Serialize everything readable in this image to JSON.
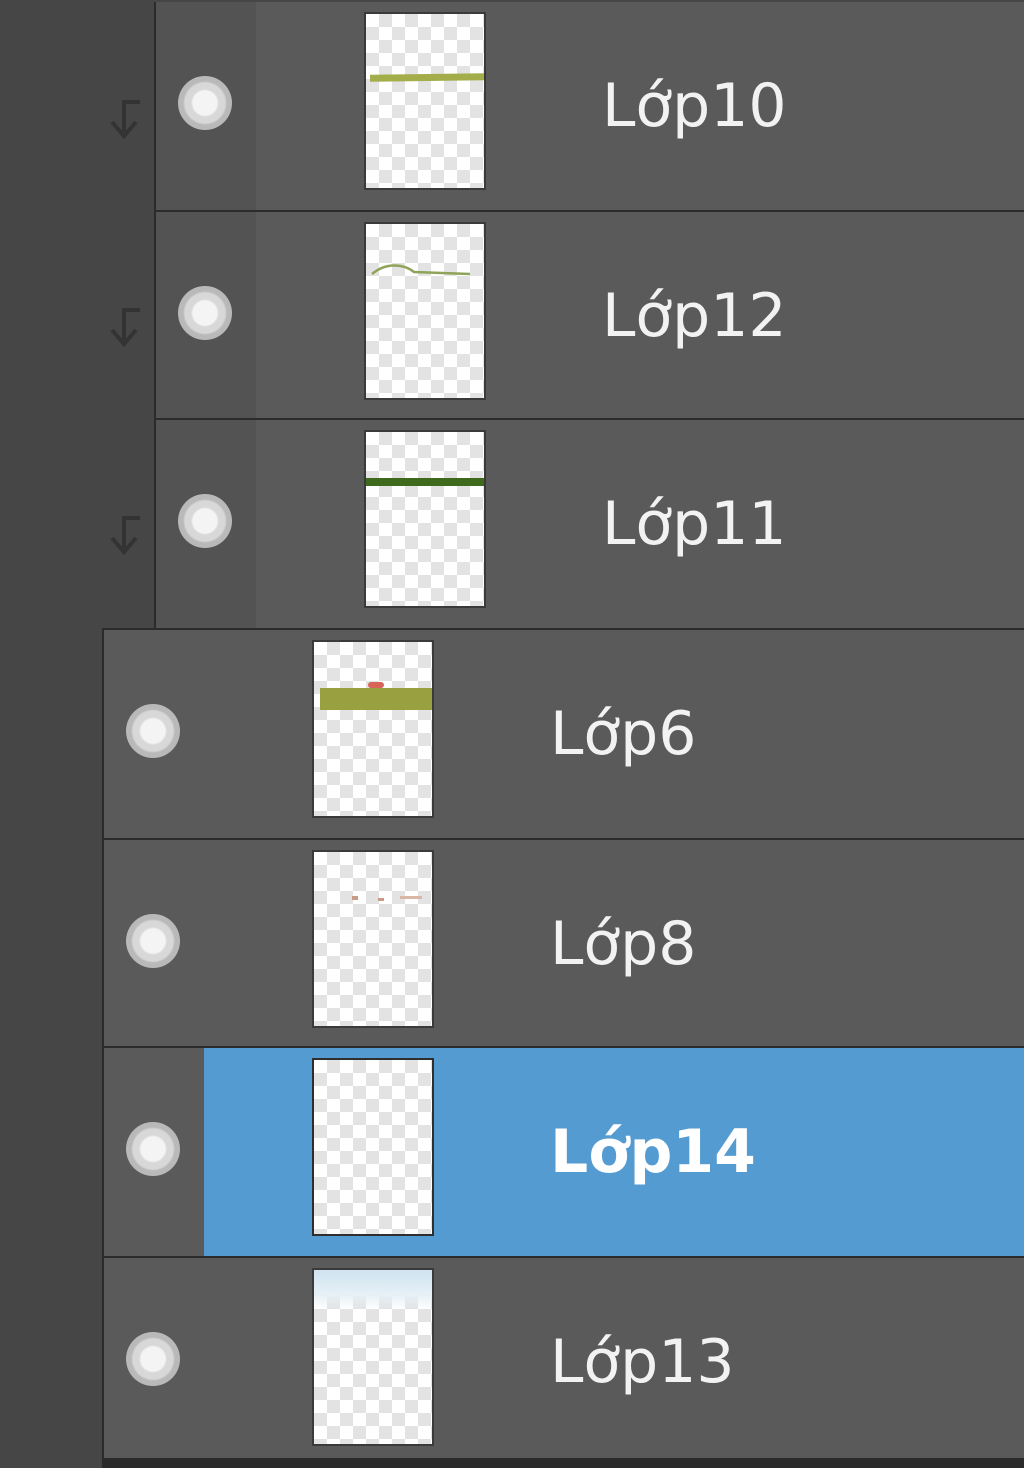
{
  "layers": [
    {
      "name": "Lớp10",
      "clipped": true,
      "selected": false,
      "thumb": "thin-yellow-green-line"
    },
    {
      "name": "Lớp12",
      "clipped": true,
      "selected": false,
      "thumb": "faint-green-sketch"
    },
    {
      "name": "Lớp11",
      "clipped": true,
      "selected": false,
      "thumb": "dark-green-line"
    },
    {
      "name": "Lớp6",
      "clipped": false,
      "selected": false,
      "thumb": "olive-band-with-red"
    },
    {
      "name": "Lớp8",
      "clipped": false,
      "selected": false,
      "thumb": "faint-red-dots"
    },
    {
      "name": "Lớp14",
      "clipped": false,
      "selected": true,
      "thumb": "empty"
    },
    {
      "name": "Lớp13",
      "clipped": false,
      "selected": false,
      "thumb": "light-blue-wash"
    }
  ],
  "icons": {
    "visibility": "eye-icon",
    "clipping": "clipping-arrow-icon"
  },
  "colors": {
    "selection": "#539bd1",
    "row": "#5a5a5a",
    "panel": "#464646"
  }
}
